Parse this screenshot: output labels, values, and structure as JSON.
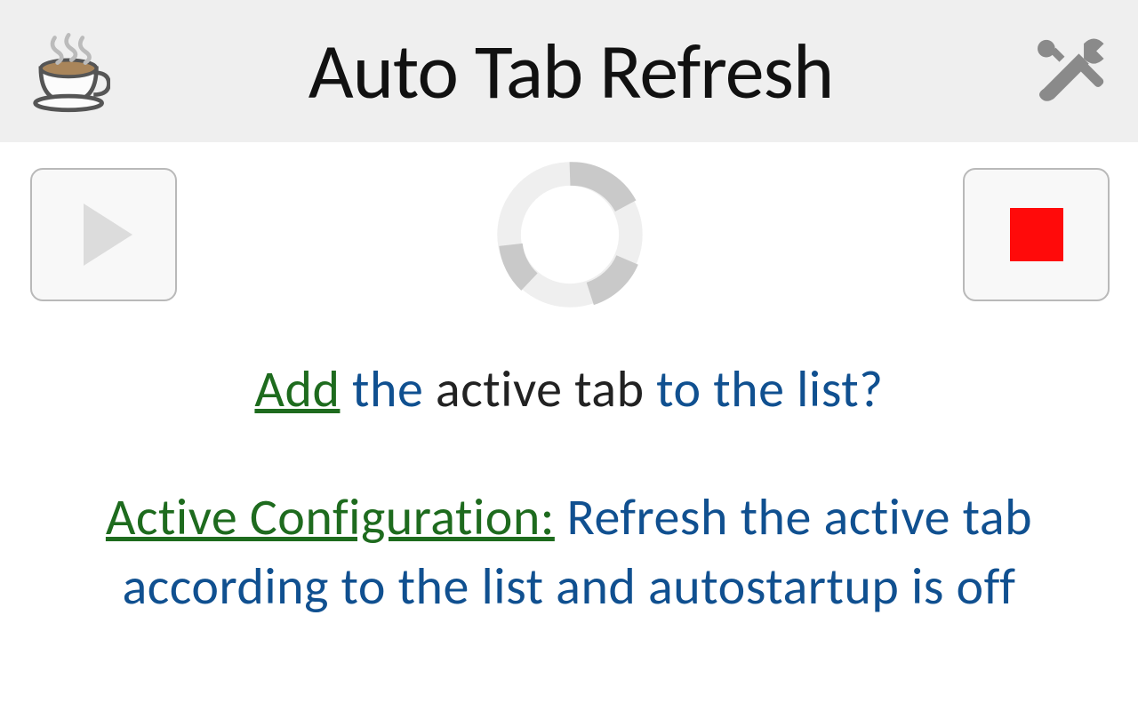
{
  "header": {
    "title": "Auto Tab Refresh",
    "coffee_icon": "coffee-cup-icon",
    "tools_icon": "tools-icon"
  },
  "controls": {
    "play_icon": "play-icon",
    "stop_icon": "stop-icon",
    "spinner_icon": "loading-spinner-icon"
  },
  "prompt": {
    "add_link": "Add",
    "segment1": " the ",
    "emph": "active tab",
    "segment2": " to the list?"
  },
  "config": {
    "label_link": "Active Configuration:",
    "text_part1": " Refresh the active tab",
    "text_part2": "according to the list and autostartup is off"
  }
}
